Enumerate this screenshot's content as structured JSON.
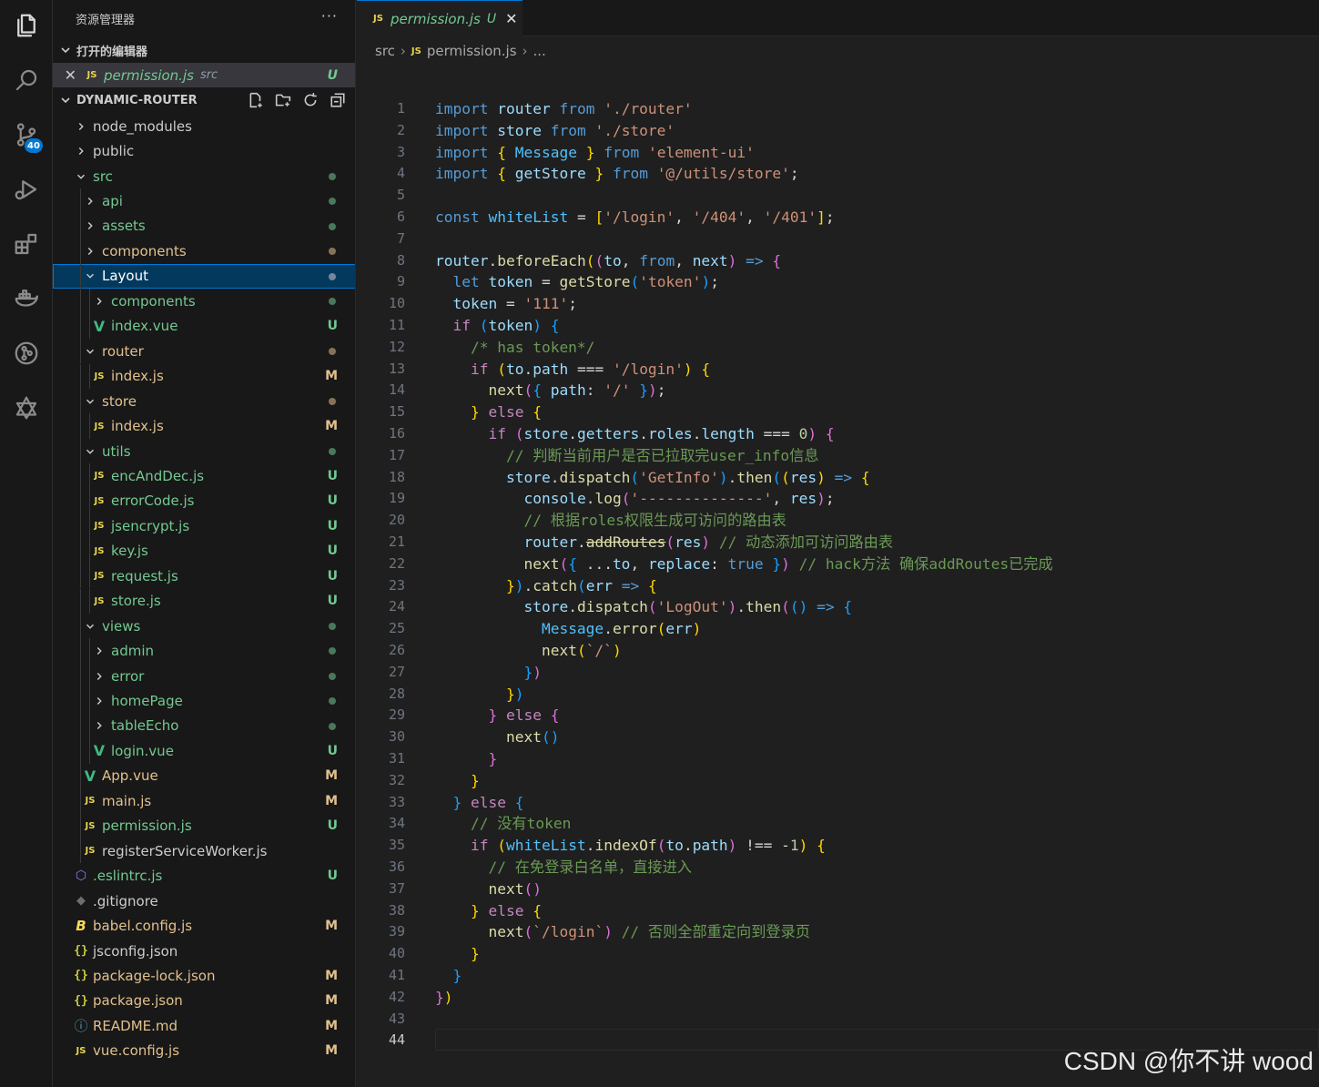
{
  "sidebar": {
    "title": "资源管理器",
    "more": "···",
    "open_editors_label": "打开的编辑器",
    "open_editor": {
      "name": "permission.js",
      "path": "src",
      "status": "U"
    },
    "project_label": "DYNAMIC-ROUTER",
    "tree": [
      {
        "label": "node_modules",
        "kind": "folder",
        "expanded": false,
        "depth": 0,
        "status": ""
      },
      {
        "label": "public",
        "kind": "folder",
        "expanded": false,
        "depth": 0,
        "status": ""
      },
      {
        "label": "src",
        "kind": "folder",
        "expanded": true,
        "depth": 0,
        "status": "dot-green"
      },
      {
        "label": "api",
        "kind": "folder",
        "expanded": false,
        "depth": 1,
        "status": "dot-green"
      },
      {
        "label": "assets",
        "kind": "folder",
        "expanded": false,
        "depth": 1,
        "status": "dot-green"
      },
      {
        "label": "components",
        "kind": "folder",
        "expanded": false,
        "depth": 1,
        "status": "dot-yellow"
      },
      {
        "label": "Layout",
        "kind": "folder",
        "expanded": true,
        "depth": 1,
        "status": "dot-green",
        "selected": true
      },
      {
        "label": "components",
        "kind": "folder",
        "expanded": false,
        "depth": 2,
        "status": "dot-green"
      },
      {
        "label": "index.vue",
        "kind": "vue",
        "depth": 2,
        "status": "U"
      },
      {
        "label": "router",
        "kind": "folder",
        "expanded": true,
        "depth": 1,
        "status": "dot-yellow"
      },
      {
        "label": "index.js",
        "kind": "js",
        "depth": 2,
        "status": "M"
      },
      {
        "label": "store",
        "kind": "folder",
        "expanded": true,
        "depth": 1,
        "status": "dot-yellow"
      },
      {
        "label": "index.js",
        "kind": "js",
        "depth": 2,
        "status": "M"
      },
      {
        "label": "utils",
        "kind": "folder",
        "expanded": true,
        "depth": 1,
        "status": "dot-green"
      },
      {
        "label": "encAndDec.js",
        "kind": "js",
        "depth": 2,
        "status": "U"
      },
      {
        "label": "errorCode.js",
        "kind": "js",
        "depth": 2,
        "status": "U"
      },
      {
        "label": "jsencrypt.js",
        "kind": "js",
        "depth": 2,
        "status": "U"
      },
      {
        "label": "key.js",
        "kind": "js",
        "depth": 2,
        "status": "U"
      },
      {
        "label": "request.js",
        "kind": "js",
        "depth": 2,
        "status": "U"
      },
      {
        "label": "store.js",
        "kind": "js",
        "depth": 2,
        "status": "U"
      },
      {
        "label": "views",
        "kind": "folder",
        "expanded": true,
        "depth": 1,
        "status": "dot-green"
      },
      {
        "label": "admin",
        "kind": "folder",
        "expanded": false,
        "depth": 2,
        "status": "dot-green"
      },
      {
        "label": "error",
        "kind": "folder",
        "expanded": false,
        "depth": 2,
        "status": "dot-green"
      },
      {
        "label": "homePage",
        "kind": "folder",
        "expanded": false,
        "depth": 2,
        "status": "dot-green"
      },
      {
        "label": "tableEcho",
        "kind": "folder",
        "expanded": false,
        "depth": 2,
        "status": "dot-green"
      },
      {
        "label": "login.vue",
        "kind": "vue",
        "depth": 2,
        "status": "U"
      },
      {
        "label": "App.vue",
        "kind": "vue",
        "depth": 1,
        "status": "M"
      },
      {
        "label": "main.js",
        "kind": "js",
        "depth": 1,
        "status": "M"
      },
      {
        "label": "permission.js",
        "kind": "js",
        "depth": 1,
        "status": "U"
      },
      {
        "label": "registerServiceWorker.js",
        "kind": "js",
        "depth": 1,
        "status": ""
      },
      {
        "label": ".eslintrc.js",
        "kind": "eslint",
        "depth": 0,
        "status": "U"
      },
      {
        "label": ".gitignore",
        "kind": "git",
        "depth": 0,
        "status": ""
      },
      {
        "label": "babel.config.js",
        "kind": "babel",
        "depth": 0,
        "status": "M"
      },
      {
        "label": "jsconfig.json",
        "kind": "json",
        "depth": 0,
        "status": ""
      },
      {
        "label": "package-lock.json",
        "kind": "json",
        "depth": 0,
        "status": "M"
      },
      {
        "label": "package.json",
        "kind": "json",
        "depth": 0,
        "status": "M"
      },
      {
        "label": "README.md",
        "kind": "info",
        "depth": 0,
        "status": "M"
      },
      {
        "label": "vue.config.js",
        "kind": "js",
        "depth": 0,
        "status": "M"
      }
    ]
  },
  "activity_bar": {
    "icons": [
      "explorer-icon",
      "search-icon",
      "source-control-icon",
      "run-debug-icon",
      "extensions-icon",
      "docker-icon",
      "git-graph-icon",
      "remote-icon"
    ],
    "scm_badge": "40"
  },
  "editor": {
    "tab": {
      "icon": "JS",
      "name": "permission.js",
      "status": "U",
      "close": "✕"
    },
    "breadcrumb": [
      "src",
      "permission.js",
      "..."
    ],
    "current_line": 44,
    "lines": [
      "import router from './router'",
      "import store from './store'",
      "import { Message } from 'element-ui'",
      "import { getStore } from '@/utils/store';",
      "",
      "const whiteList = ['/login', '/404', '/401'];",
      "",
      "router.beforeEach((to, from, next) => {",
      "  let token = getStore('token');",
      "  token = '111';",
      "  if (token) {",
      "    /* has token*/",
      "    if (to.path === '/login') {",
      "      next({ path: '/' });",
      "    } else {",
      "      if (store.getters.roles.length === 0) {",
      "        // 判断当前用户是否已拉取完user_info信息",
      "        store.dispatch('GetInfo').then((res) => {",
      "          console.log('--------------', res);",
      "          // 根据roles权限生成可访问的路由表",
      "          router.addRoutes(res) // 动态添加可访问路由表",
      "          next({ ...to, replace: true }) // hack方法 确保addRoutes已完成",
      "        }).catch(err => {",
      "          store.dispatch('LogOut').then(() => {",
      "            Message.error(err)",
      "            next(`/`)",
      "          })",
      "        })",
      "      } else {",
      "        next()",
      "      }",
      "    }",
      "  } else {",
      "    // 没有token",
      "    if (whiteList.indexOf(to.path) !== -1) {",
      "      // 在免登录白名单，直接进入",
      "      next()",
      "    } else {",
      "      next(`/login`) // 否则全部重定向到登录页",
      "    }",
      "  }",
      "})",
      "",
      ""
    ]
  },
  "watermark": "CSDN @你不讲 wood",
  "colors": {
    "keyword": "#569cd6",
    "control": "#c586c0",
    "string": "#ce9178",
    "variable": "#9cdcfe",
    "function": "#dcdcaa",
    "comment": "#6a9955",
    "untracked": "#73c991",
    "modified": "#e2c08d",
    "accent": "#0078d4"
  }
}
